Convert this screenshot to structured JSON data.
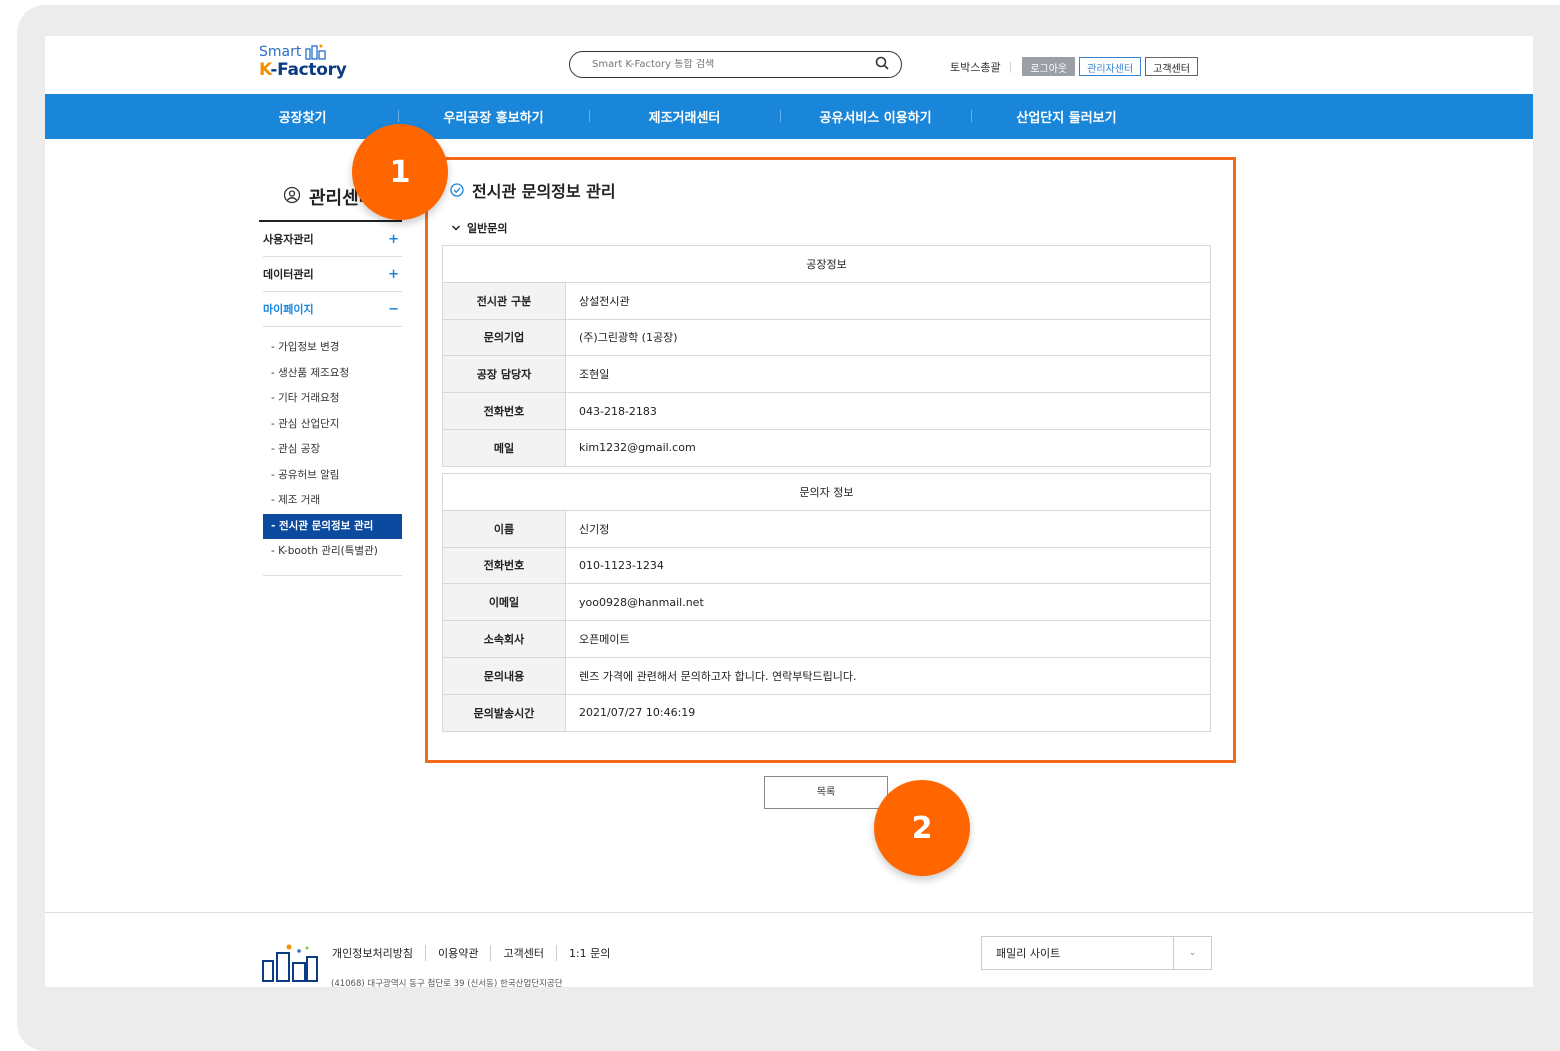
{
  "header": {
    "logo_top": "Smart",
    "logo_bottom_k": "K",
    "logo_bottom_rest": "-Factory",
    "search_placeholder": "Smart K-Factory 통합 검색",
    "user": "토박스총괄",
    "logout": "로그아웃",
    "admin_center": "관리자센터",
    "customer_center": "고객센터"
  },
  "nav": [
    "공장찾기",
    "우리공장 홍보하기",
    "제조거래센터",
    "공유서비스 이용하기",
    "산업단지 둘러보기"
  ],
  "sidebar": {
    "title": "관리센터",
    "menus": [
      {
        "label": "사용자관리",
        "sign": "+"
      },
      {
        "label": "데이터관리",
        "sign": "+"
      },
      {
        "label": "마이페이지",
        "sign": "−"
      }
    ],
    "sub_items": [
      "가입정보 변경",
      "생산품 제조요청",
      "기타 거래요청",
      "관심 산업단지",
      "관심 공장",
      "공유허브 알림",
      "제조 거래",
      "전시관 문의정보 관리",
      "K-booth 관리(특별관)"
    ],
    "active_sub": "전시관 문의정보 관리"
  },
  "content": {
    "page_title": "전시관 문의정보 관리",
    "section_title": "일반문의",
    "factory_group": "공장정보",
    "factory_rows": [
      {
        "label": "전시관 구분",
        "value": "상설전시관"
      },
      {
        "label": "문의기업",
        "value": "(주)그린광학 (1공장)"
      },
      {
        "label": "공장 담당자",
        "value": "조현일"
      },
      {
        "label": "전화번호",
        "value": "043-218-2183"
      },
      {
        "label": "메일",
        "value": "kim1232@gmail.com"
      }
    ],
    "inquirer_group": "문의자 정보",
    "inquirer_rows": [
      {
        "label": "이름",
        "value": "신기정"
      },
      {
        "label": "전화번호",
        "value": "010-1123-1234"
      },
      {
        "label": "이메일",
        "value": "yoo0928@hanmail.net"
      },
      {
        "label": "소속회사",
        "value": "오픈메이트"
      },
      {
        "label": "문의내용",
        "value": "렌즈 가격에 관련해서 문의하고자 합니다. 연락부탁드립니다."
      },
      {
        "label": "문의발송시간",
        "value": "2021/07/27 10:46:19"
      }
    ],
    "list_button": "목록"
  },
  "markers": [
    "1",
    "2"
  ],
  "footer": {
    "links": [
      "개인정보처리방침",
      "이용약관",
      "고객센터",
      "1:1 문의"
    ],
    "address": "(41068) 대구광역시 동구 첨단로 39 (신서동) 한국산업단지공단",
    "family_site": "패밀리 사이트"
  },
  "colors": {
    "primary_blue": "#1a86da",
    "active_navy": "#0c4aa0",
    "highlight_orange": "#f26b1d",
    "marker_orange": "#ff6600"
  }
}
